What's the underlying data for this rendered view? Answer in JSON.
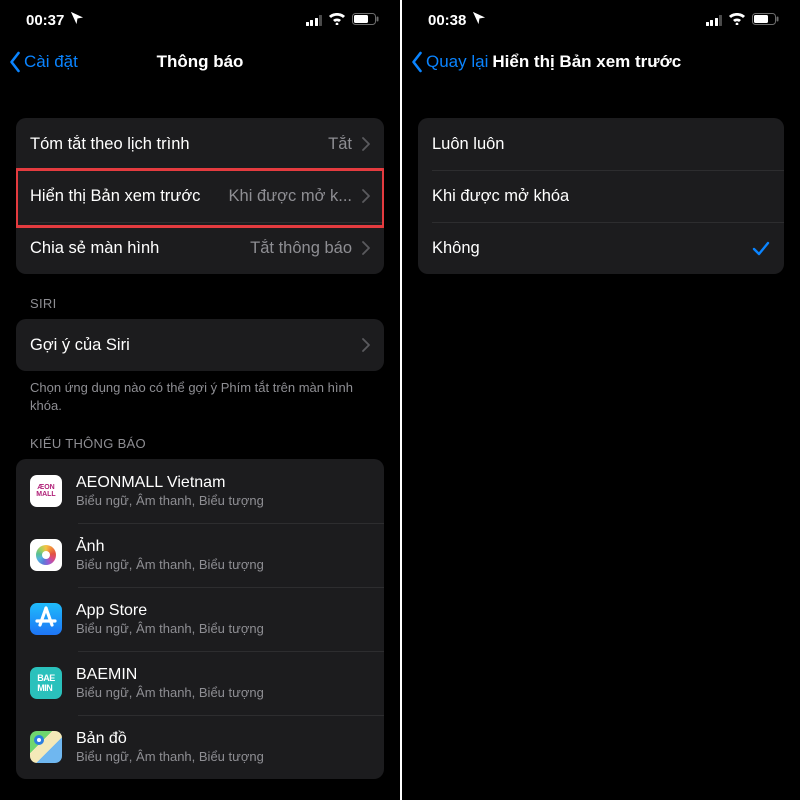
{
  "left": {
    "status": {
      "time": "00:37"
    },
    "nav": {
      "back": "Cài đặt",
      "title": "Thông báo"
    },
    "rows": {
      "schedule": {
        "label": "Tóm tắt theo lịch trình",
        "value": "Tắt"
      },
      "preview": {
        "label": "Hiển thị Bản xem trước",
        "value": "Khi được mở k..."
      },
      "screen": {
        "label": "Chia sẻ màn hình",
        "value": "Tắt thông báo"
      }
    },
    "siri": {
      "header": "SIRI",
      "suggestions": "Gợi ý của Siri",
      "footer": "Chọn ứng dụng nào có thể gợi ý Phím tắt trên màn hình khóa."
    },
    "style_header": "KIỂU THÔNG BÁO",
    "app_subtitle": "Biểu ngữ, Âm thanh, Biểu tượng",
    "apps": {
      "aeon": "AEONMALL Vietnam",
      "photos": "Ảnh",
      "appstore": "App Store",
      "baemin": "BAEMIN",
      "maps": "Bản đồ"
    }
  },
  "right": {
    "status": {
      "time": "00:38"
    },
    "nav": {
      "back": "Quay lại",
      "title": "Hiển thị Bản xem trước"
    },
    "options": {
      "always": "Luôn luôn",
      "unlocked": "Khi được mở khóa",
      "never": "Không"
    }
  }
}
